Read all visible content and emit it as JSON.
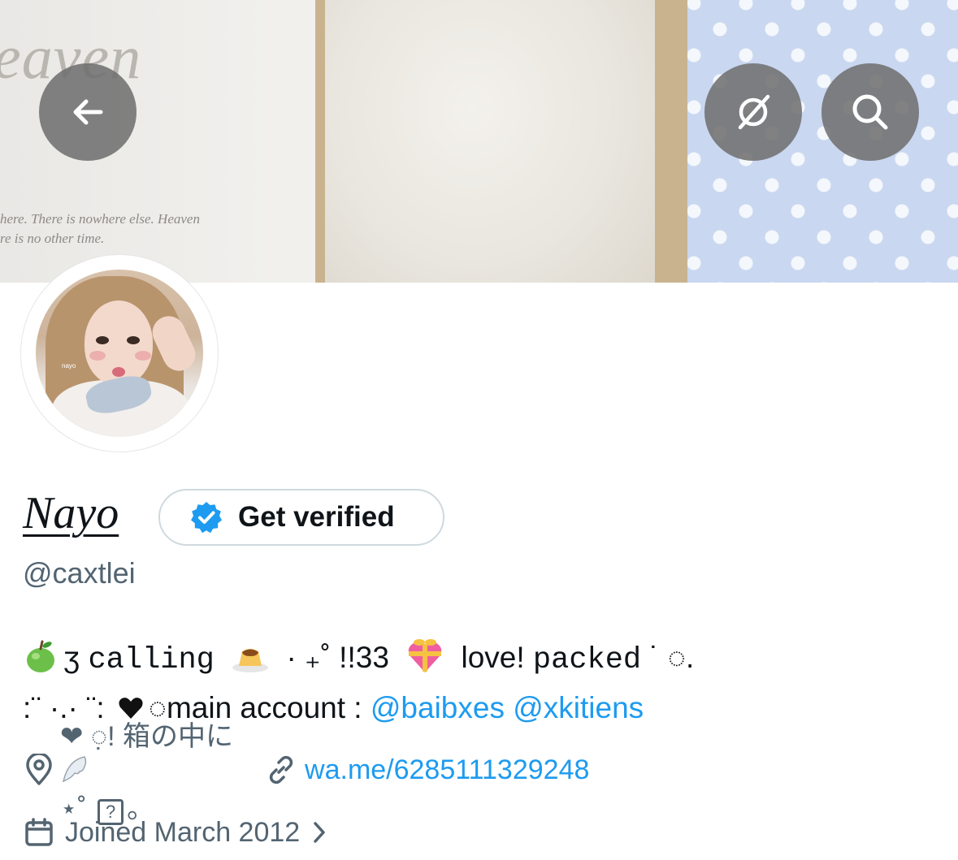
{
  "banner": {
    "word": "eaven",
    "quote_line_1": "here. There is nowhere else. Heaven",
    "quote_line_2": "re is no other time."
  },
  "avatar": {
    "tag_text": "nayo"
  },
  "profile": {
    "display_name": "Nayo",
    "verify_label": "Get verified",
    "handle": "@caxtlei"
  },
  "bio": {
    "l1_a": "ʒ",
    "l1_word": "calling",
    "l1_b": "· ₊˚ !!33",
    "l1_c": "love!",
    "l1_word2": "packed",
    "l1_d": "˙ ◌.",
    "l2_a": ":¨ ·.· ¨:",
    "l2_b": "◌main account :",
    "mention_1": "@baibxes",
    "mention_2": "@xkitiens"
  },
  "meta": {
    "location_a": "❤︎ ◌̣! 箱の中に",
    "location_b": "⋆˚",
    "location_box": "?",
    "location_c": "。",
    "link": "wa.me/6285111329248",
    "joined": "Joined March 2012"
  },
  "icons": {
    "back": "arrow-left-icon",
    "translate": "translate-off-icon",
    "search": "search-icon",
    "verified": "verified-badge-icon",
    "location": "location-pin-icon",
    "link": "link-icon",
    "calendar": "calendar-icon",
    "chevron": "chevron-right-icon"
  },
  "colors": {
    "accent": "#1d9bf0",
    "muted": "#536471",
    "text": "#0f1419",
    "overlay_button": "#6e6e6e"
  }
}
